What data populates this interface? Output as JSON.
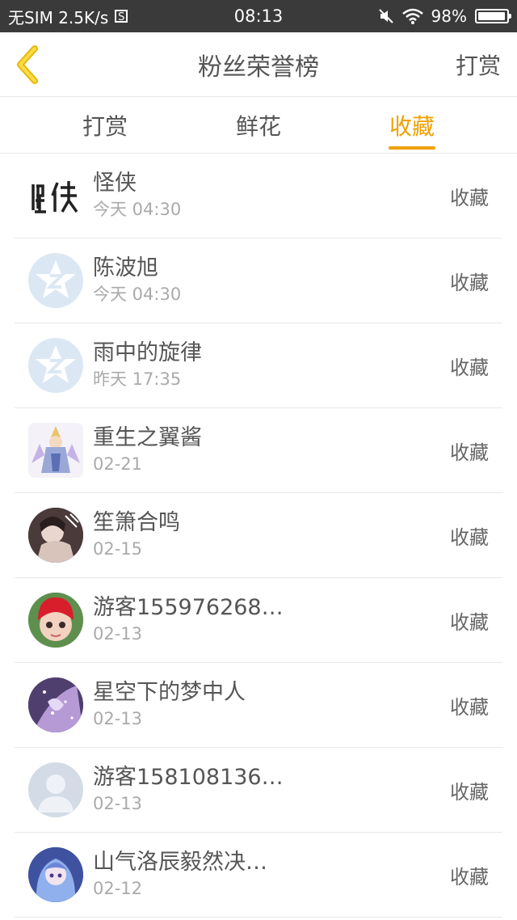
{
  "status_bar": {
    "carrier": "无SIM 2.5K/s",
    "s_icon": "S",
    "time": "08:13",
    "battery": "98%",
    "battery_level": 0.98,
    "icons": [
      "mute-icon",
      "wifi-icon",
      "battery-icon"
    ]
  },
  "header": {
    "title": "粉丝荣誉榜",
    "action_label": "打赏",
    "back_icon": "chevron-left-icon",
    "accent_color": "#f0c419"
  },
  "tabs": [
    {
      "label": "打赏",
      "active": false
    },
    {
      "label": "鲜花",
      "active": false
    },
    {
      "label": "收藏",
      "active": true
    }
  ],
  "colors": {
    "active_tab": "#f0a000",
    "status_bar": "#3a3a3a"
  },
  "rows": [
    {
      "name": "怪侠",
      "date": "今天 04:30",
      "action": "收藏",
      "avatar": "calligraphy-logo"
    },
    {
      "name": "陈波旭",
      "date": "今天 04:30",
      "action": "收藏",
      "avatar": "default-qq-star"
    },
    {
      "name": "雨中的旋律",
      "date": "昨天 17:35",
      "action": "收藏",
      "avatar": "default-qq-star"
    },
    {
      "name": "重生之翼酱",
      "date": "02-21",
      "action": "收藏",
      "avatar": "anime-character"
    },
    {
      "name": "笙箫合鸣",
      "date": "02-15",
      "action": "收藏",
      "avatar": "dark-illustration"
    },
    {
      "name": "游客155976268…",
      "date": "02-13",
      "action": "收藏",
      "avatar": "doll-red-hat"
    },
    {
      "name": "星空下的梦中人",
      "date": "02-13",
      "action": "收藏",
      "avatar": "purple-starry"
    },
    {
      "name": "游客158108136…",
      "date": "02-13",
      "action": "收藏",
      "avatar": "default-person"
    },
    {
      "name": "山气洛辰毅然决…",
      "date": "02-12",
      "action": "收藏",
      "avatar": "blue-anime-girl"
    }
  ]
}
